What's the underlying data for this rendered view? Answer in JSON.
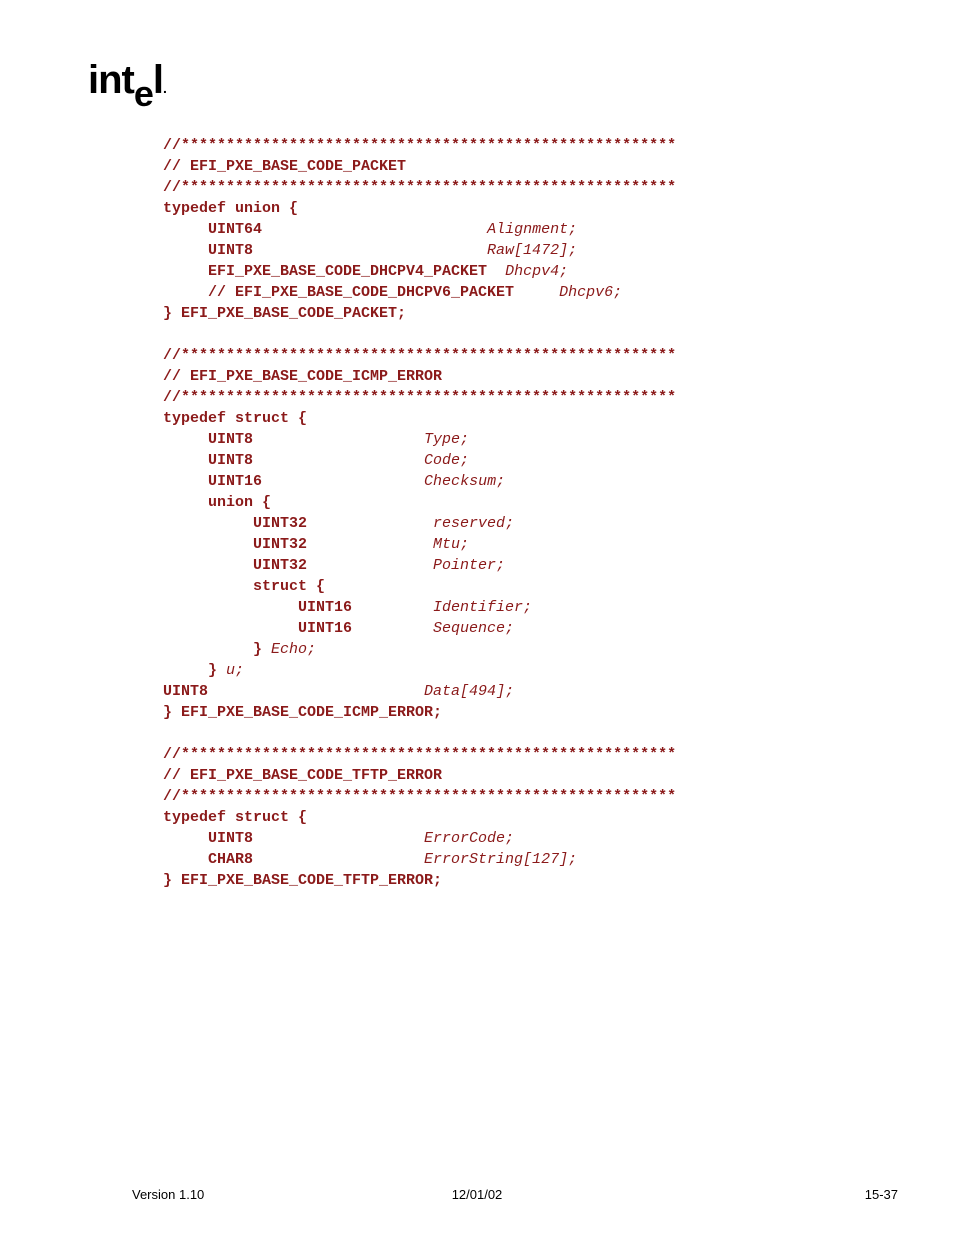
{
  "logo": "intel",
  "code": {
    "sep1a": "//*******************************************************",
    "title1": "// EFI_PXE_BASE_CODE_PACKET",
    "sep1b": "//*******************************************************",
    "union1": "typedef union {",
    "u1_l1_t": "     UINT64",
    "u1_l1_v": "                         Alignment;",
    "u1_l2_t": "     UINT8",
    "u1_l2_v": "                          Raw[1472];",
    "u1_l3_t": "     EFI_PXE_BASE_CODE_DHCPV4_PACKET",
    "u1_l3_v": "  Dhcpv4;",
    "u1_l4_t": "     // EFI_PXE_BASE_CODE_DHCPV6_PACKET",
    "u1_l4_v": "     Dhcpv6;",
    "u1_close": "} EFI_PXE_BASE_CODE_PACKET;",
    "blank1": "",
    "sep2a": "//*******************************************************",
    "title2": "// EFI_PXE_BASE_CODE_ICMP_ERROR",
    "sep2b": "//*******************************************************",
    "struct2": "typedef struct {",
    "s2_l1_t": "     UINT8",
    "s2_l1_v": "                   Type;",
    "s2_l2_t": "     UINT8",
    "s2_l2_v": "                   Code;",
    "s2_l3_t": "     UINT16",
    "s2_l3_v": "                  Checksum;",
    "s2_union": "     union {",
    "s2_u_l1_t": "          UINT32",
    "s2_u_l1_v": "              reserved;",
    "s2_u_l2_t": "          UINT32",
    "s2_u_l2_v": "              Mtu;",
    "s2_u_l3_t": "          UINT32",
    "s2_u_l3_v": "              Pointer;",
    "s2_u_struct": "          struct {",
    "s2_us_l1_t": "               UINT16",
    "s2_us_l1_v": "         Identifier;",
    "s2_us_l2_t": "               UINT16",
    "s2_us_l2_v": "         Sequence;",
    "s2_us_close_b": "          }",
    "s2_us_close_v": " Echo;",
    "s2_u_close_b": "     }",
    "s2_u_close_v": " u;",
    "s2_l4_t": "UINT8",
    "s2_l4_v": "                        Data[494];",
    "s2_close": "} EFI_PXE_BASE_CODE_ICMP_ERROR;",
    "blank2": "",
    "sep3a": "//*******************************************************",
    "title3": "// EFI_PXE_BASE_CODE_TFTP_ERROR",
    "sep3b": "//*******************************************************",
    "struct3": "typedef struct {",
    "s3_l1_t": "     UINT8",
    "s3_l1_v": "                   ErrorCode;",
    "s3_l2_t": "     CHAR8",
    "s3_l2_v": "                   ErrorString[127];",
    "s3_close": "} EFI_PXE_BASE_CODE_TFTP_ERROR;"
  },
  "footer": {
    "left": "Version 1.10",
    "center": "12/01/02",
    "right": "15-37"
  }
}
